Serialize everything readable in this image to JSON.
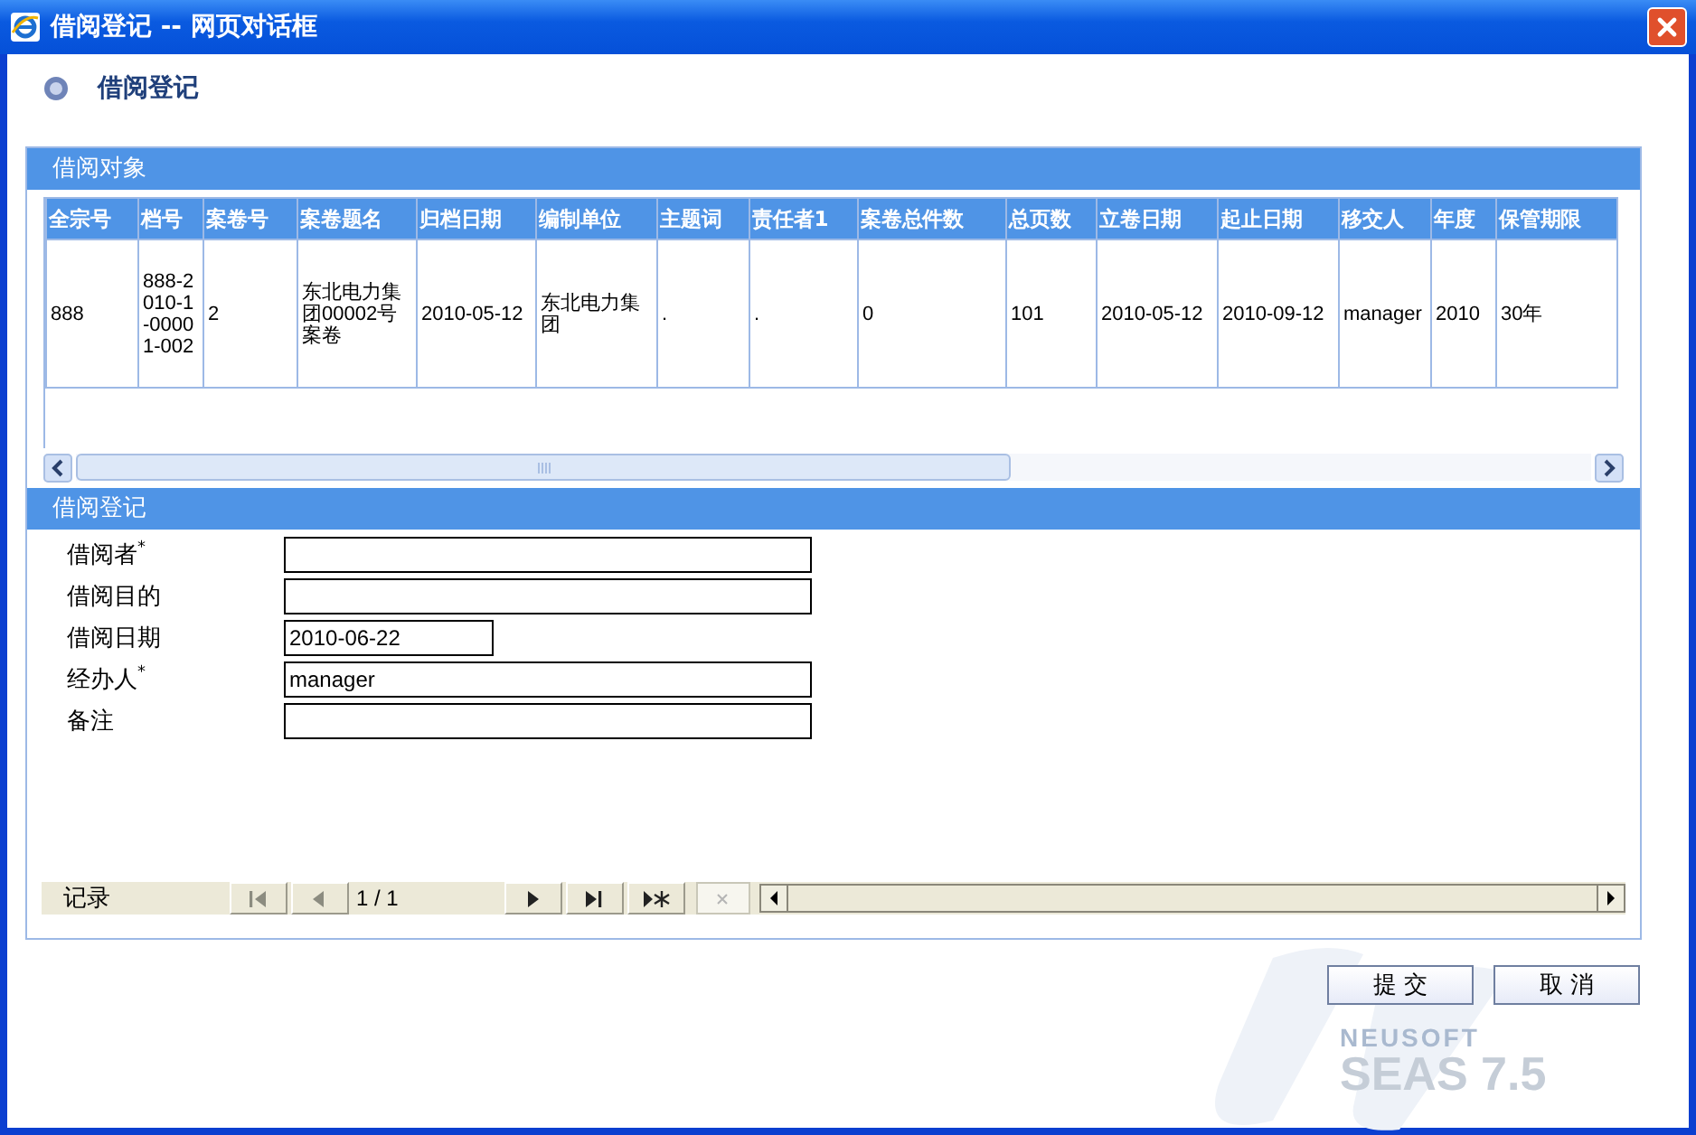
{
  "window": {
    "title": "借阅登记 -- 网页对话框"
  },
  "heading": "借阅登记",
  "object_panel": {
    "title": "借阅对象",
    "table": {
      "columns": [
        "全宗号",
        "档号",
        "案卷号",
        "案卷题名",
        "归档日期",
        "编制单位",
        "主题词",
        "责任者1",
        "案卷总件数",
        "总页数",
        "立卷日期",
        "起止日期",
        "移交人",
        "年度",
        "保管期限"
      ],
      "rows": [
        [
          "888",
          "888-2010-1-00001-002",
          "2",
          "东北电力集团00002号案卷",
          "2010-05-12",
          "东北电力集团",
          ".",
          ".",
          "0",
          "101",
          "2010-05-12",
          "2010-09-12",
          "manager",
          "2010",
          "30年"
        ]
      ]
    }
  },
  "register_panel": {
    "title": "借阅登记",
    "fields": [
      {
        "label": "借阅者$^{*}$",
        "kind": "text"
      },
      {
        "label": "借阅目的",
        "kind": "text"
      },
      {
        "label": "借阅日期",
        "kind": "date",
        "value": "2010-06-22"
      },
      {
        "label": "经办人$^{*}$",
        "kind": "text",
        "value": "manager"
      },
      {
        "label": "备注",
        "kind": "text"
      }
    ],
    "navigator": {
      "label": "记录",
      "position": "1 / 1",
      "buttons": [
        {
          "kind": "first",
          "disabled": true
        },
        {
          "kind": "prev",
          "disabled": true
        },
        {
          "kind": "next",
          "disabled": false
        },
        {
          "kind": "last",
          "disabled": false
        },
        {
          "kind": "new",
          "disabled": false
        },
        {
          "kind": "delete",
          "disabled": true
        }
      ]
    }
  },
  "buttons": [
    "提 交",
    "取 消"
  ],
  "brand": {
    "company": "NEUSOFT",
    "product": "SEAS 7.5"
  }
}
